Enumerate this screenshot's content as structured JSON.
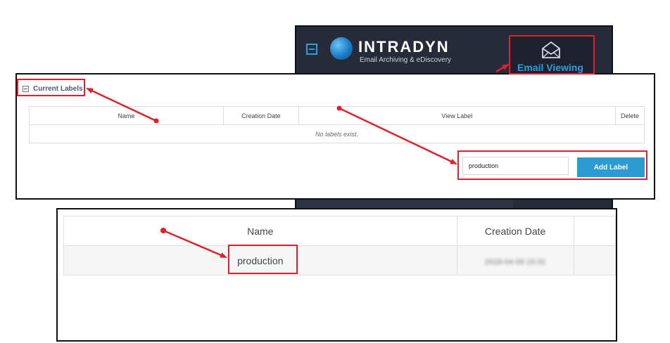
{
  "header": {
    "brand": "INTRADYN",
    "tagline": "Email Archiving & eDiscovery",
    "email_tab_label": "Email Viewing"
  },
  "labels_section": {
    "title": "Current Labels",
    "columns": [
      "Name",
      "Creation Date",
      "View Label",
      "Delete"
    ],
    "empty_message": "No labels exist.",
    "new_label_value": "production",
    "add_button_label": "Add Label"
  },
  "result": {
    "columns": [
      "Name",
      "Creation Date"
    ],
    "rows": [
      {
        "name": "production",
        "creation_date": "2018-04-09 15:31"
      }
    ]
  },
  "colors": {
    "accent_blue": "#2b9bd1",
    "callout_red": "#e0202a",
    "header_bg": "#262b3a"
  },
  "icons": {
    "email_tab": "envelope-icon",
    "collapse": "minus-square-icon"
  }
}
